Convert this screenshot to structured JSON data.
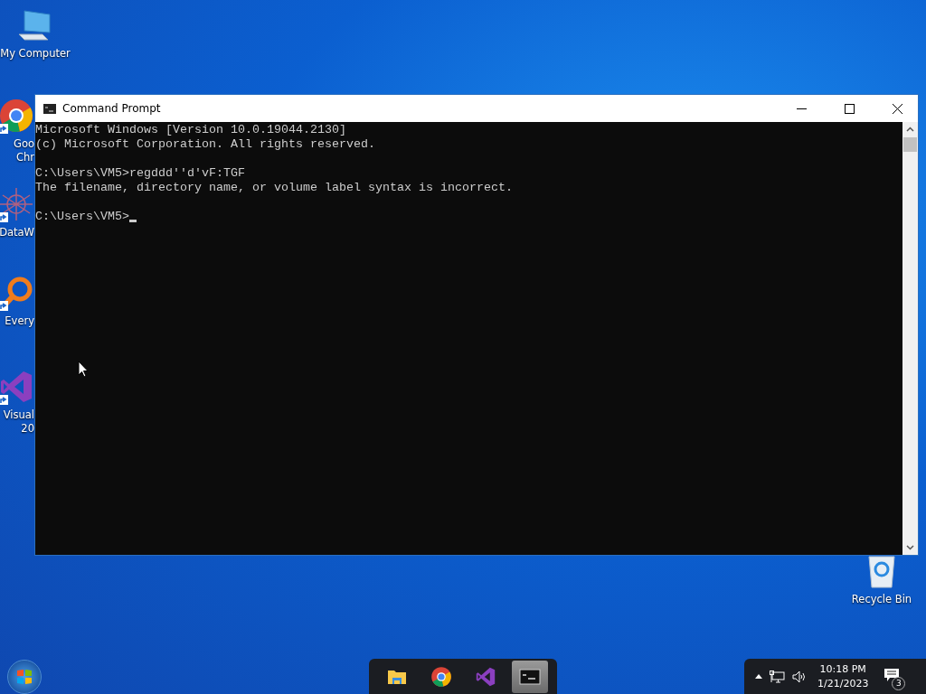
{
  "desktop_icons": [
    {
      "kind": "computer",
      "shortcut": false,
      "lines": [
        "My Computer"
      ]
    },
    {
      "kind": "chrome",
      "shortcut": true,
      "lines": [
        "Goo",
        "Chr"
      ]
    },
    {
      "kind": "network",
      "shortcut": true,
      "lines": [
        "DataW"
      ]
    },
    {
      "kind": "magnifier",
      "shortcut": true,
      "lines": [
        "Every"
      ]
    },
    {
      "kind": "vs",
      "shortcut": true,
      "lines": [
        "Visual",
        "20"
      ]
    },
    {
      "kind": "recycle",
      "shortcut": false,
      "lines": [
        "Recycle Bin"
      ]
    }
  ],
  "window": {
    "title": "Command Prompt",
    "blocks": [
      [
        "Microsoft Windows [Version 10.0.19044.2130]",
        "(c) Microsoft Corporation. All rights reserved."
      ],
      [
        "C:\\Users\\VM5>regddd''d'vF:TGF",
        "The filename, directory name, or volume label syntax is incorrect."
      ],
      [
        "C:\\Users\\VM5>"
      ]
    ],
    "cursor": true
  },
  "taskbar": {
    "apps": [
      {
        "kind": "folder",
        "selected": false
      },
      {
        "kind": "chrome",
        "selected": false
      },
      {
        "kind": "vs",
        "selected": false
      },
      {
        "kind": "console",
        "selected": true
      }
    ],
    "time": "10:18 PM",
    "date": "1/21/2023",
    "notifications": "3"
  }
}
